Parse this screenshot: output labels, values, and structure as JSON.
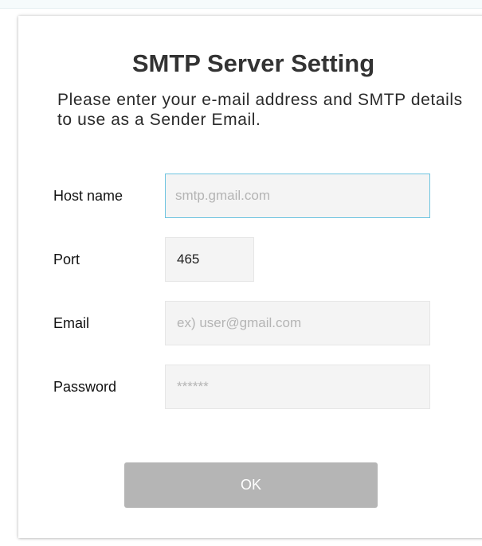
{
  "dialog": {
    "title": "SMTP Server Setting",
    "subtitle": "Please enter your e-mail address and SMTP details to use as a Sender Email."
  },
  "form": {
    "host": {
      "label": "Host name",
      "value": "",
      "placeholder": "smtp.gmail.com"
    },
    "port": {
      "label": "Port",
      "value": "465",
      "placeholder": ""
    },
    "email": {
      "label": "Email",
      "value": "",
      "placeholder": "ex) user@gmail.com"
    },
    "password": {
      "label": "Password",
      "value": "",
      "placeholder": "******"
    }
  },
  "actions": {
    "ok_label": "OK"
  },
  "colors": {
    "button_bg": "#b5b5b5",
    "focus_border": "#6ec4e0",
    "input_bg": "#f4f4f4",
    "title_text": "#333333"
  }
}
